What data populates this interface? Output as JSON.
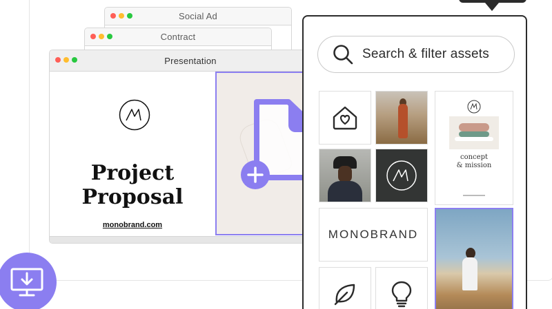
{
  "windows": {
    "social_ad": {
      "title": "Social Ad"
    },
    "contract": {
      "title": "Contract"
    },
    "presentation": {
      "title": "Presentation"
    }
  },
  "slide": {
    "title_line1": "Project",
    "title_line2": "Proposal",
    "url": "monobrand.com"
  },
  "assets_panel": {
    "search_placeholder": "Search & filter assets",
    "tiles": [
      {
        "icon": "house-heart-icon"
      },
      {
        "image": "woman-in-field-photo"
      },
      {
        "card_text_line1": "concept",
        "card_text_line2": "& mission"
      },
      {
        "image": "man-in-hat-photo"
      },
      {
        "icon": "monobrand-logo"
      },
      {
        "wordmark": "MONOBRAND"
      },
      {
        "image": "man-in-wheat-field-photo",
        "selected": true
      },
      {
        "icon": "leaf-icon"
      },
      {
        "icon": "lightbulb-icon"
      }
    ]
  },
  "colors": {
    "accent": "#8b7ef0",
    "panel_border": "#2b2b2b"
  },
  "icons": {
    "add": "plus-icon",
    "file": "file-icon",
    "badge": "monitor-download-icon"
  }
}
